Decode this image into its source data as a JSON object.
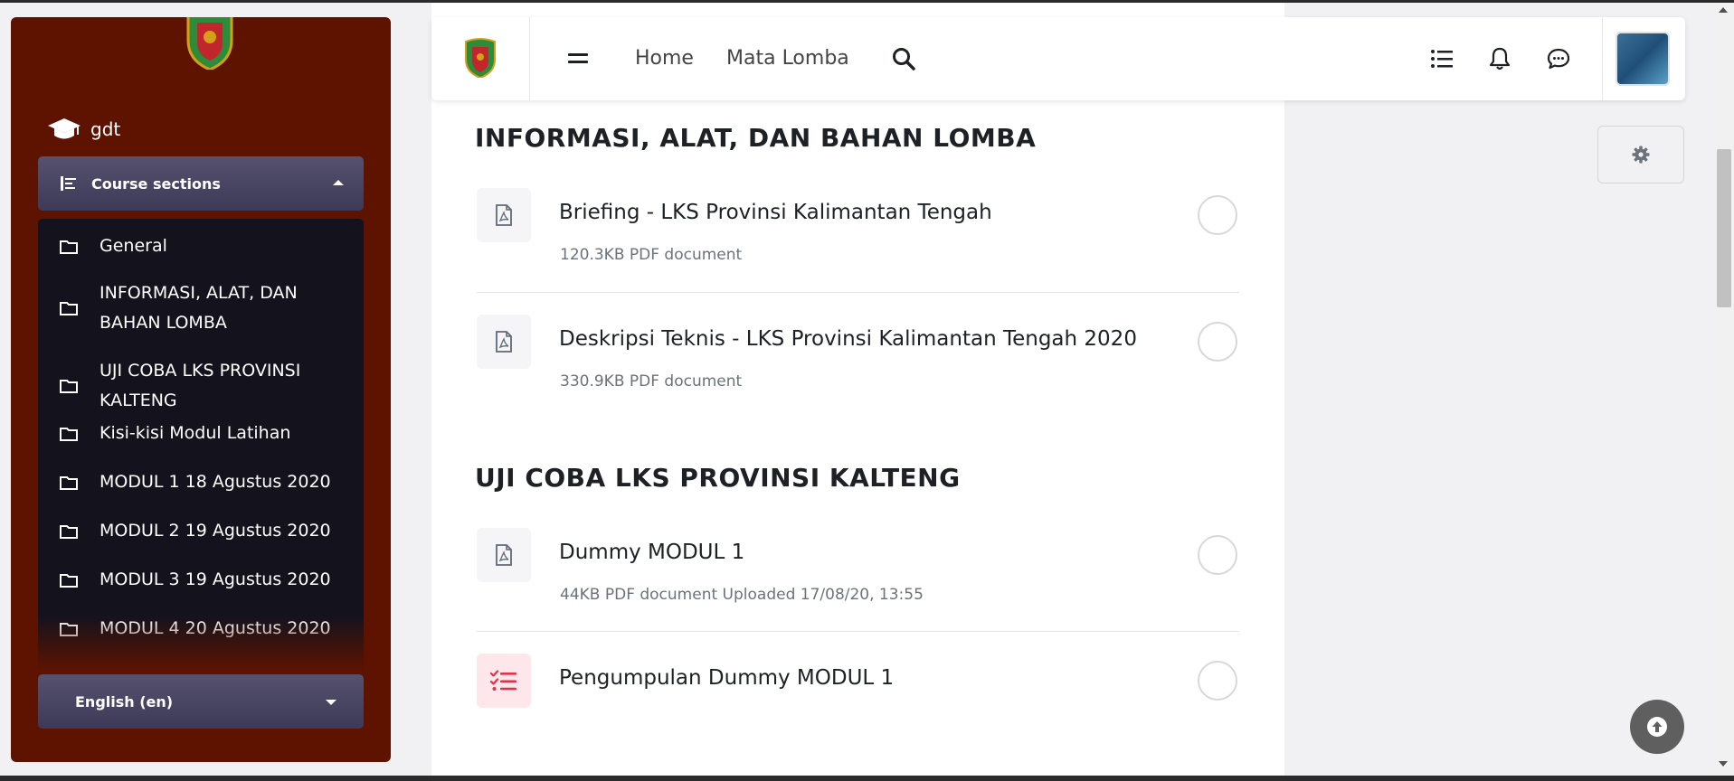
{
  "sidebar": {
    "course_name": "gdt",
    "sections_header": "Course sections",
    "sections": [
      "General",
      "INFORMASI, ALAT, DAN BAHAN LOMBA",
      "UJI COBA LKS PROVINSI KALTENG",
      "Kisi-kisi Modul Latihan",
      "MODUL 1 18 Agustus 2020",
      "MODUL 2 19 Agustus 2020",
      "MODUL 3 19 Agustus 2020",
      "MODUL 4 20 Agustus 2020"
    ],
    "language": "English (en)"
  },
  "header": {
    "nav": [
      "Home",
      "Mata Lomba"
    ],
    "icons": [
      "menu-icon",
      "search-icon",
      "list-icon",
      "bell-icon",
      "chat-icon"
    ]
  },
  "main": {
    "sections": [
      {
        "title": "INFORMASI, ALAT, DAN BAHAN LOMBA",
        "activities": [
          {
            "name": "Briefing - LKS Provinsi Kalimantan Tengah",
            "meta": "120.3KB PDF document",
            "icon": "pdf-icon"
          },
          {
            "name": "Deskripsi Teknis - LKS Provinsi Kalimantan Tengah 2020",
            "meta": "330.9KB PDF document",
            "icon": "pdf-icon"
          }
        ]
      },
      {
        "title": "UJI COBA LKS PROVINSI KALTENG",
        "activities": [
          {
            "name": "Dummy MODUL 1",
            "meta": "44KB PDF document Uploaded 17/08/20, 13:55",
            "icon": "pdf-icon"
          },
          {
            "name": "Pengumpulan Dummy MODUL 1",
            "meta": "",
            "icon": "assignment-icon"
          }
        ]
      }
    ]
  },
  "colors": {
    "sidebar_bg": "#5e1300",
    "section_list_bg": "#14131d",
    "header_button_bg": "#4a4766",
    "assignment_accent": "#e4304a"
  }
}
